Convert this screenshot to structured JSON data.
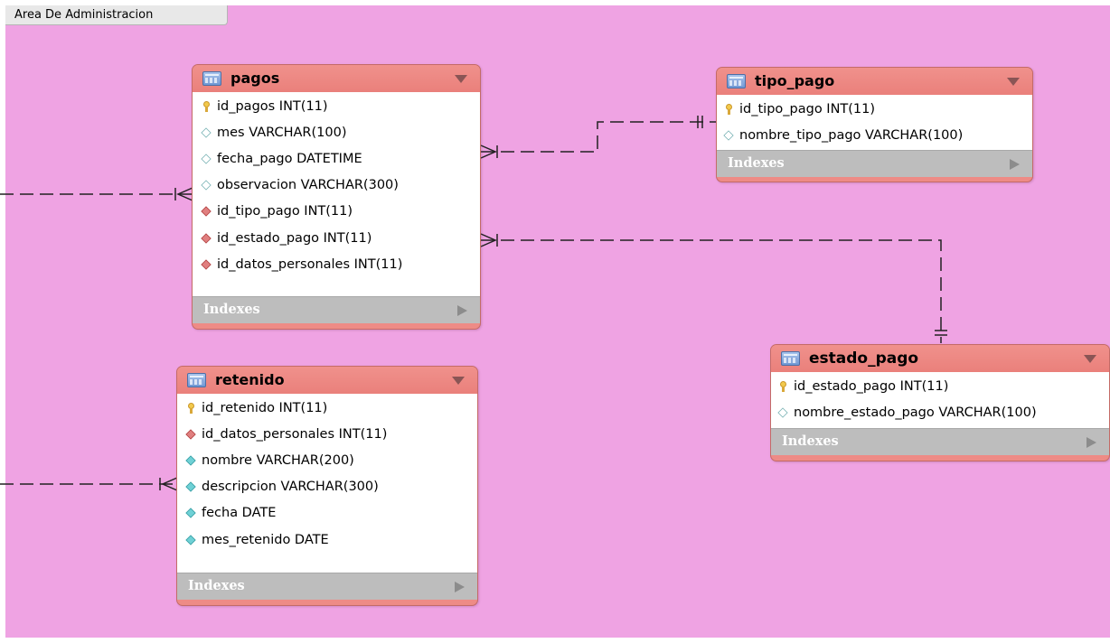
{
  "area": {
    "title": "Area De Administracion"
  },
  "tables": {
    "pagos": {
      "name": "pagos",
      "indexes_label": "Indexes",
      "columns": [
        {
          "kind": "pk",
          "text": "id_pagos INT(11)"
        },
        {
          "kind": "col",
          "text": "mes VARCHAR(100)"
        },
        {
          "kind": "col",
          "text": "fecha_pago DATETIME"
        },
        {
          "kind": "col",
          "text": "observacion VARCHAR(300)"
        },
        {
          "kind": "fk",
          "text": "id_tipo_pago INT(11)"
        },
        {
          "kind": "fk",
          "text": "id_estado_pago INT(11)"
        },
        {
          "kind": "fk",
          "text": "id_datos_personales INT(11)"
        }
      ]
    },
    "tipo_pago": {
      "name": "tipo_pago",
      "indexes_label": "Indexes",
      "columns": [
        {
          "kind": "pk",
          "text": "id_tipo_pago INT(11)"
        },
        {
          "kind": "col",
          "text": "nombre_tipo_pago VARCHAR(100)"
        }
      ]
    },
    "retenido": {
      "name": "retenido",
      "indexes_label": "Indexes",
      "columns": [
        {
          "kind": "pk",
          "text": "id_retenido INT(11)"
        },
        {
          "kind": "fk",
          "text": "id_datos_personales INT(11)"
        },
        {
          "kind": "nn",
          "text": "nombre VARCHAR(200)"
        },
        {
          "kind": "nn",
          "text": "descripcion VARCHAR(300)"
        },
        {
          "kind": "nn",
          "text": "fecha DATE"
        },
        {
          "kind": "nn",
          "text": "mes_retenido DATE"
        }
      ]
    },
    "estado_pago": {
      "name": "estado_pago",
      "indexes_label": "Indexes",
      "columns": [
        {
          "kind": "pk",
          "text": "id_estado_pago INT(11)"
        },
        {
          "kind": "col",
          "text": "nombre_estado_pago VARCHAR(100)"
        }
      ]
    }
  },
  "colors": {
    "area_background": "#efa3e3",
    "table_header": "#ee8b86",
    "indexes_bar": "#bdbdbd",
    "connector": "#222222"
  }
}
